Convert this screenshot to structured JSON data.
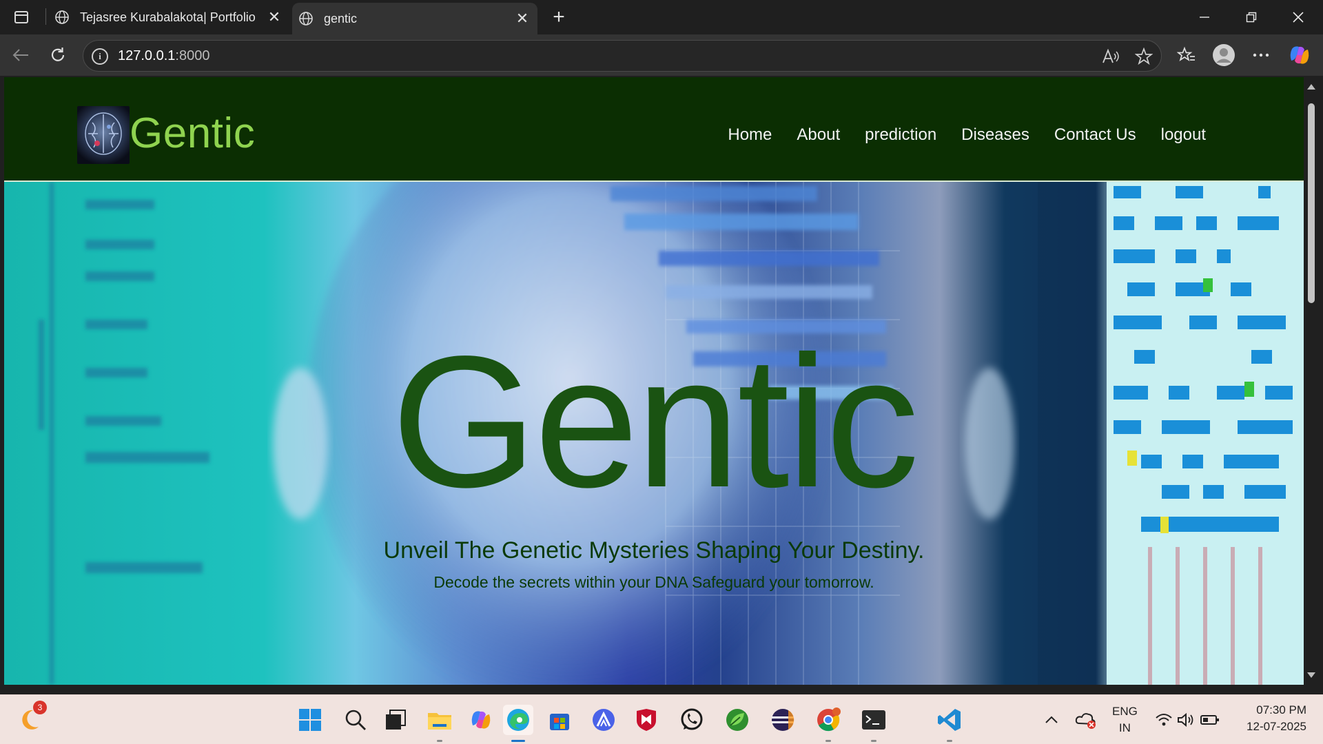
{
  "browser": {
    "tabs": [
      {
        "title": "Tejasree Kurabalakota| Portfolio",
        "active": false
      },
      {
        "title": "gentic",
        "active": true
      }
    ],
    "url_host": "127.0.0.1",
    "url_port": ":8000",
    "window_controls": [
      "minimize",
      "restore",
      "close"
    ]
  },
  "site": {
    "brand": "Gentic",
    "nav": [
      "Home",
      "About",
      "prediction",
      "Diseases",
      "Contact Us",
      "logout"
    ],
    "hero": {
      "title": "Gentic",
      "tagline": "Unveil The Genetic Mysteries Shaping Your Destiny.",
      "subtagline": "Decode the secrets within your DNA Safeguard your tomorrow."
    }
  },
  "taskbar": {
    "notification_badge": "3",
    "apps": [
      "start",
      "search",
      "task-view",
      "file-explorer",
      "copilot",
      "edge",
      "microsoft-store",
      "app-launcher",
      "mcafee",
      "whatsapp",
      "green-app",
      "eclipse",
      "chrome",
      "terminal",
      "vscode"
    ],
    "language_line1": "ENG",
    "language_line2": "IN",
    "time": "07:30 PM",
    "date": "12-07-2025"
  },
  "colors": {
    "nav_bg": "#0b2e02",
    "brand_green": "#8fd34f",
    "hero_title": "#1a5312"
  }
}
